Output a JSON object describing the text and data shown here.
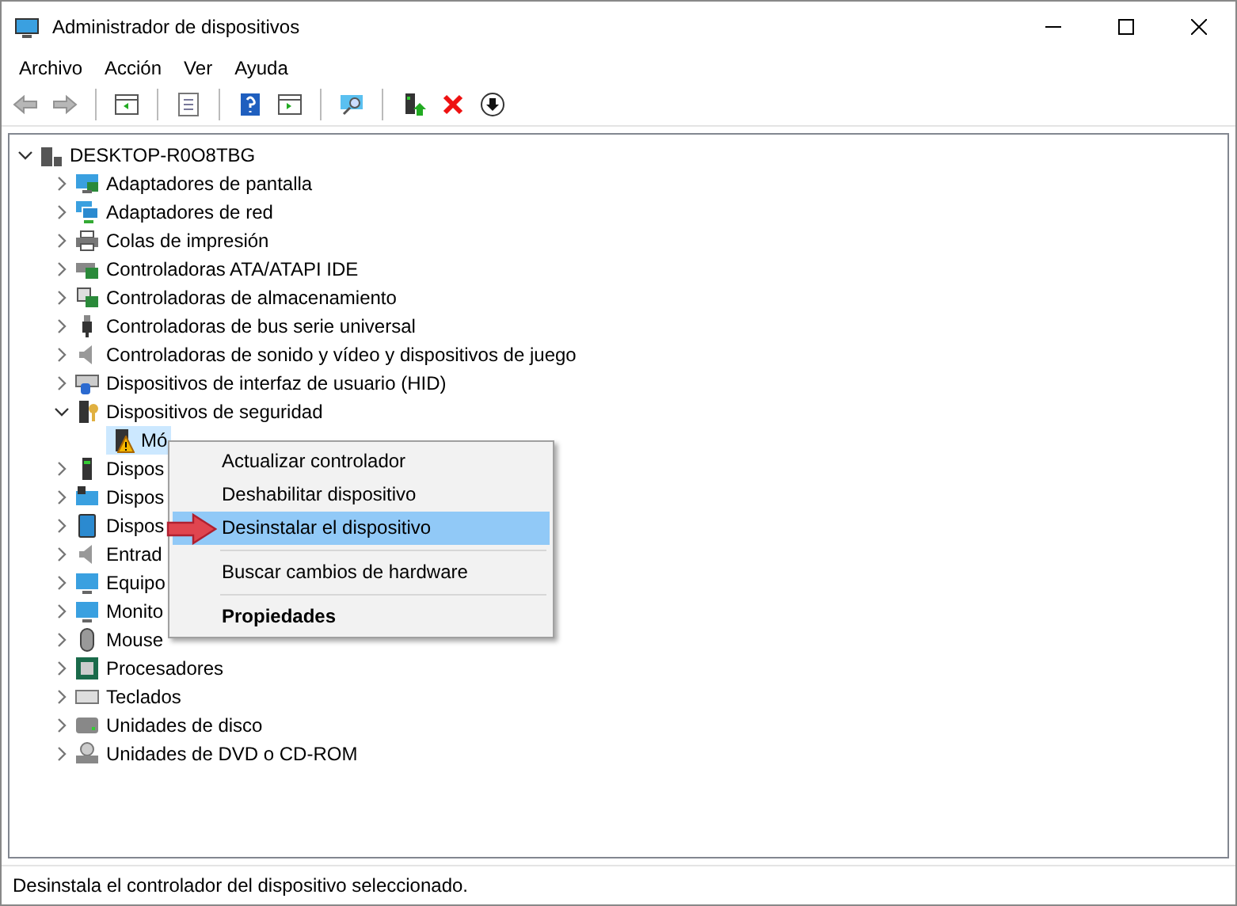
{
  "window": {
    "title": "Administrador de dispositivos"
  },
  "menu_bar": [
    "Archivo",
    "Acción",
    "Ver",
    "Ayuda"
  ],
  "toolbar": [
    {
      "kind": "back",
      "disabled": true
    },
    {
      "kind": "forward",
      "disabled": true
    },
    {
      "kind": "sep"
    },
    {
      "kind": "panel",
      "disabled": false
    },
    {
      "kind": "sep"
    },
    {
      "kind": "props",
      "disabled": false
    },
    {
      "kind": "sep"
    },
    {
      "kind": "help",
      "disabled": false
    },
    {
      "kind": "panel2",
      "disabled": false
    },
    {
      "kind": "sep"
    },
    {
      "kind": "scan",
      "disabled": false
    },
    {
      "kind": "sep"
    },
    {
      "kind": "update",
      "disabled": false
    },
    {
      "kind": "remove",
      "disabled": false
    },
    {
      "kind": "download",
      "disabled": false
    }
  ],
  "tree": {
    "label": "DESKTOP-R0O8TBG",
    "expanded": true,
    "children": [
      {
        "label": "Adaptadores de pantalla",
        "expanded": false
      },
      {
        "label": "Adaptadores de red",
        "expanded": false
      },
      {
        "label": "Colas de impresión",
        "expanded": false
      },
      {
        "label": "Controladoras ATA/ATAPI IDE",
        "expanded": false
      },
      {
        "label": "Controladoras de almacenamiento",
        "expanded": false
      },
      {
        "label": "Controladoras de bus serie universal",
        "expanded": false
      },
      {
        "label": "Controladoras de sonido y vídeo y dispositivos de juego",
        "expanded": false
      },
      {
        "label": "Dispositivos de interfaz de usuario (HID)",
        "expanded": false
      },
      {
        "label": "Dispositivos de seguridad",
        "expanded": true,
        "children": [
          {
            "label": "Mó",
            "selected": true,
            "warning": true
          }
        ]
      },
      {
        "label": "Dispos",
        "expanded": false
      },
      {
        "label": "Dispos",
        "expanded": false
      },
      {
        "label": "Dispos",
        "expanded": false
      },
      {
        "label": "Entrad",
        "expanded": false
      },
      {
        "label": "Equipo",
        "expanded": false
      },
      {
        "label": "Monito",
        "expanded": false
      },
      {
        "label": "Mouse",
        "expanded": false
      },
      {
        "label": "Procesadores",
        "expanded": false
      },
      {
        "label": "Teclados",
        "expanded": false
      },
      {
        "label": "Unidades de disco",
        "expanded": false
      },
      {
        "label": "Unidades de DVD o CD-ROM",
        "expanded": false
      }
    ]
  },
  "context_menu": [
    {
      "kind": "item",
      "label": "Actualizar controlador",
      "selected": false,
      "bold": false
    },
    {
      "kind": "item",
      "label": "Deshabilitar dispositivo",
      "selected": false,
      "bold": false
    },
    {
      "kind": "item",
      "label": "Desinstalar el dispositivo",
      "selected": true,
      "bold": false
    },
    {
      "kind": "separator"
    },
    {
      "kind": "item",
      "label": "Buscar cambios de hardware",
      "selected": false,
      "bold": false
    },
    {
      "kind": "separator"
    },
    {
      "kind": "item",
      "label": "Propiedades",
      "selected": false,
      "bold": true
    }
  ],
  "status_bar": "Desinstala el controlador del dispositivo seleccionado."
}
